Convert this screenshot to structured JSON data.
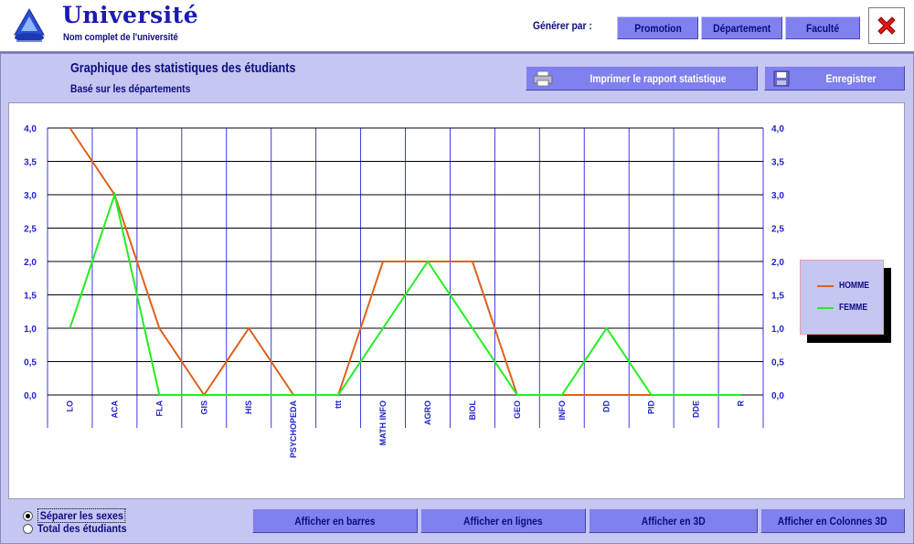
{
  "header": {
    "title": "Université",
    "subtitle": "Nom complet de l'université",
    "generate_label": "Générer par :",
    "buttons": {
      "promotion": "Promotion",
      "department": "Département",
      "faculty": "Faculté"
    },
    "close_icon": "close-icon"
  },
  "panel": {
    "title": "Graphique des statistiques des étudiants",
    "subtitle": "Basé sur les départements",
    "print_label": "Imprimer le rapport statistique",
    "print_icon": "printer-icon",
    "save_label": "Enregistrer",
    "save_icon": "floppy-disk-icon"
  },
  "chart_data": {
    "type": "line",
    "categories": [
      "LO",
      "ACA",
      "FLA",
      "GIS",
      "HIS",
      "PSYCHOPEDA",
      "ttt",
      "MATH INFO",
      "AGRO",
      "BIOL",
      "GEO",
      "INFO",
      "DD",
      "PID",
      "DDE",
      "R"
    ],
    "series": [
      {
        "name": "HOMME",
        "color": "#e0601a",
        "values": [
          4,
          3,
          1,
          0,
          1,
          0,
          0,
          2,
          2,
          2,
          0,
          0,
          0,
          0,
          0,
          0
        ]
      },
      {
        "name": "FEMME",
        "color": "#22ee22",
        "values": [
          1,
          3,
          0,
          0,
          0,
          0,
          0,
          1,
          2,
          1,
          0,
          0,
          1,
          0,
          0,
          0
        ]
      }
    ],
    "yticks": [
      "4,0",
      "3,5",
      "3,0",
      "2,5",
      "2,0",
      "1,5",
      "1,0",
      "0,5",
      "0,0"
    ],
    "yticks_right": [
      "4,0",
      "3,5",
      "3,0",
      "2,5",
      "2,0",
      "1,5",
      "1,0",
      "0,5",
      "0,0"
    ],
    "ylim": [
      0,
      4
    ],
    "grid": true,
    "legend_position": "right"
  },
  "options": {
    "separate_label": "Séparer les sexes",
    "total_label": "Total des étudiants",
    "selected": "separate"
  },
  "bottom_buttons": {
    "bars": "Afficher en barres",
    "lines": "Afficher en lignes",
    "three_d": "Afficher en 3D",
    "columns_3d": "Afficher en Colonnes 3D"
  },
  "colors": {
    "accent": "#8080ee",
    "panel": "#c6c6f2",
    "text": "#0c0c80",
    "grid_vertical": "#3a3ae0",
    "axis_text": "#2222cc"
  }
}
